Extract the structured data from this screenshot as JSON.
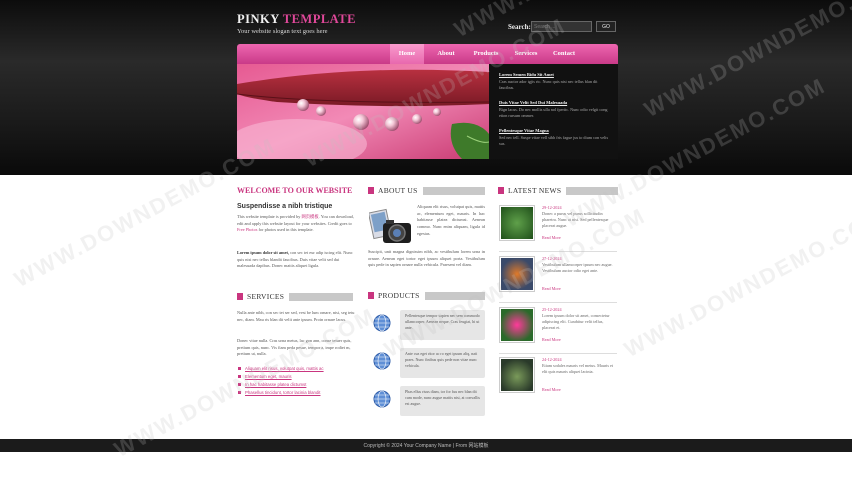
{
  "header": {
    "logo_part1": "PINKY",
    "logo_part2": "TEMPLATE",
    "slogan": "Your website slogan text goes here",
    "search_label": "Search:",
    "search_placeholder": "Search ...",
    "search_button": "GO"
  },
  "nav": {
    "items": [
      {
        "label": "Home",
        "active": true
      },
      {
        "label": "About"
      },
      {
        "label": "Products"
      },
      {
        "label": "Services"
      },
      {
        "label": "Contact"
      }
    ]
  },
  "banner": {
    "news": [
      {
        "title": "Lorem Semen Bidu Sit Amet",
        "desc": "Cras auctor ador tgjis ric. Nunc quis nisi nec tellus blan dit faucibus."
      },
      {
        "title": "Duis Vitae Velit Sed Dui Malesuada",
        "desc": "Bign lacus. Do nec mollis ulla nol fperitc. Nunc odio velgit cong etion rursum ommer."
      },
      {
        "title": "Pellentesque Vitae Magna",
        "desc": "Sed nec tell. Suspe vitae vell sibh fris fague jus to dium con velis sus."
      }
    ]
  },
  "welcome": {
    "heading": "WELCOME TO OUR WEBSITE",
    "subheading": "Suspendisse a nibh tristique",
    "p1_a": "This website template is provided by ",
    "p1_link1": "网页模板",
    "p1_b": ". You can download, edit and apply this website layout for your websites. Credit goes to ",
    "p1_link2": "Free Photos",
    "p1_c": " for photos used in this template.",
    "p2_bold": "Lorem ipsum dolor sit amet,",
    "p2_rest": " con sec tet eur adip iscing elit. Nunc quis nisi nec tellus blandit faucibus. Duis vitae velit sed dui malesuada dapibus. Donec mattis aliquet ligula."
  },
  "services": {
    "heading": "SERVICES",
    "p1": "Nulla ante nibh, con sec tet ser sed, vest be lum ornare, nisi, seg tetu nec, diam. Mau ris blan dit velit ante ipsum. Proin ornare lacus.",
    "p2": "Donec vitae nulla. Cras urna metus, lac gon ann, conse tetuer quis, pretium quis, nunc. Vis fiam peda pesue, tempor a, impe rodiet m, pretium ut, nulla.",
    "links": [
      "Aliquam elit risus, volutpat quis, mattis ac",
      "Elementum eget, mauris",
      "In hac habitasse platea dictumst",
      "Phasellus tincidunt, tortor lacinia blandit"
    ]
  },
  "about": {
    "heading": "ABOUT US",
    "p1": "Aliquam elit risus, volutpat quis, mattis ac, elementum eget, mauris. In hac habitasse platea dictumst. Aenean commo. Nunc enim aliquam, ligula id egestas.",
    "p2": "Suscipit, unit magna dignissim nibh, ac vestibulum lorem urna in ornare. Aenean eget tortor eget ipsum aliquet porta. Vestibulum quis pede in sapien ornare nulla vehicula. Praesent vel diam."
  },
  "products": {
    "heading": "PRODUCTS",
    "items": [
      "Pellentesque tempor sapien nec sem commodo ullamcorper. Aenean neque. Cras feugiat, hi ut ante.",
      "Ante cuz eget ritor ac ro eget ipsum aliq, nati praes. Nunc finibus quis pede non vitae nunc vehicula.",
      "Phas ellus risus diam, tor for fuu nec blan dit cum mode, nunc augue mattis nisi, at convallis est augue."
    ]
  },
  "latest_news": {
    "heading": "LATEST NEWS",
    "items": [
      {
        "date": "29-12-2024",
        "desc": "Donec a purus vel purus sollicitudin pharetra. Nunc at nisi. Sed pellentesque placerat augue.",
        "more": "Read More"
      },
      {
        "date": "27-12-2024",
        "desc": "Vestibulum ullamcorper ipsum nec augue. Vestibulum auctor odio eget ante.",
        "more": "Read More"
      },
      {
        "date": "25-12-2024",
        "desc": "Lorem ipsum dolor sit amet, consectetur adipiscing elit. Curabitur velit tellus, placerat et.",
        "more": "Read More"
      },
      {
        "date": "24-12-2024",
        "desc": "Etiam sodales mauris vel metus. Mauris et elit quis mauris aliquet lacinia.",
        "more": "Read More"
      }
    ]
  },
  "footer": {
    "text": "Copyright © 2024 Your Company Name | From 网站模板"
  },
  "watermark": "WWW.DOWNDEMO.COM",
  "colors": {
    "accent": "#c9357f",
    "nav": "#e0489a",
    "dark": "#1b1b1b"
  }
}
